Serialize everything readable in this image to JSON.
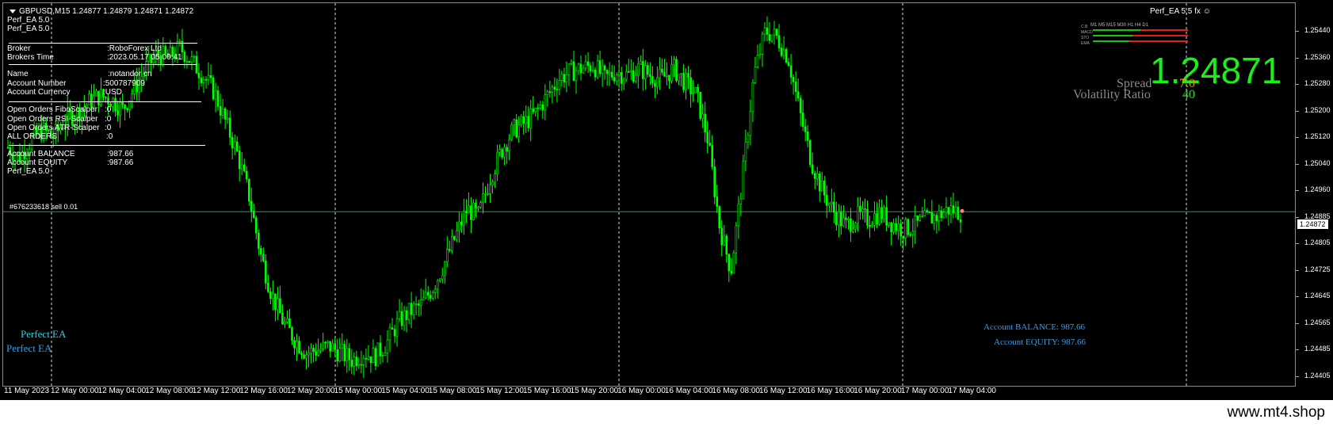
{
  "chart": {
    "symbol_line": "GBPUSD,M15  1.24877 1.24879 1.24871 1.24872",
    "ea_title_right": "Perf_EA 5.5",
    "ea_title_suffix": "fx",
    "ea_name_1": "Perf_EA 5.0",
    "ea_name_2": "Perf_EA 5.0",
    "current_price_tag": "1.24872",
    "order_line_label": "#676233618 sell 0.01"
  },
  "info_panel": {
    "broker_label": "Broker",
    "broker_value": ":RoboForex Ltd",
    "brokers_time_label": "Brokers Time",
    "brokers_time_value": ":2023.05.17 05:00:41",
    "name_label": "Name",
    "name_value": ":notandor cn",
    "account_number_label": "Account Number",
    "account_number_value": ":500787909",
    "account_currency_label": "Account Currency",
    "account_currency_value": ":USD",
    "oo_fibo_label": "Open Orders FiboScalper",
    "oo_fibo_value": ":0",
    "oo_rsi_label": "Open Orders RSI-Scalper",
    "oo_rsi_value": ":0",
    "oo_atr_label": "Open Orders ATR-Scalper",
    "oo_atr_value": ":0",
    "all_orders_label": "ALL ORDERS",
    "all_orders_value": ":0",
    "balance_label": "Account BALANCE",
    "balance_value": ":987.66",
    "equity_label": "Account EQUITY",
    "equity_value": ":987.66",
    "footer_name": "Perf_EA 5.0"
  },
  "quote_panel": {
    "big_price": "1.24871",
    "spread_label": "Spread",
    "spread_value": "7.0",
    "volatility_label": "Volatility Ratio",
    "volatility_value": "40",
    "timeframes": [
      "M1",
      "M5",
      "M15",
      "M30",
      "H1",
      "H4",
      "D1"
    ],
    "indicator_rows": [
      "C.B",
      "MACD",
      "STO",
      "EMA"
    ]
  },
  "bottom_left": {
    "label_1": "Perfect EA",
    "label_2": "Perfect EA"
  },
  "bottom_right": {
    "balance_text": "Account BALANCE:  987.66",
    "equity_text": "Account EQUITY:  987.66"
  },
  "price_axis": [
    "1.25440",
    "1.25360",
    "1.25280",
    "1.25200",
    "1.25120",
    "1.25040",
    "1.24960",
    "1.24885",
    "1.24805",
    "1.24725",
    "1.24645",
    "1.24565",
    "1.24485",
    "1.24405"
  ],
  "time_axis": [
    "11 May 2023",
    "12 May 00:00",
    "12 May 04:00",
    "12 May 08:00",
    "12 May 12:00",
    "12 May 16:00",
    "12 May 20:00",
    "15 May 00:00",
    "15 May 04:00",
    "15 May 08:00",
    "15 May 12:00",
    "15 May 16:00",
    "15 May 20:00",
    "16 May 00:00",
    "16 May 04:00",
    "16 May 08:00",
    "16 May 12:00",
    "16 May 16:00",
    "16 May 20:00",
    "17 May 00:00",
    "17 May 04:00"
  ],
  "footer": {
    "brand": "www.mt4.shop"
  },
  "colors": {
    "candle": "#00ff00",
    "price_big": "#19f019",
    "spread_value": "#ff8c00",
    "volatility_value": "#19f019",
    "order_line": "#1f9f6a",
    "bottom_left_label_1": "#2fd0e0",
    "bottom_left_label_2": "#2fa0e0",
    "bottom_right_text": "#3a9ae8"
  },
  "chart_data": {
    "type": "candlestick",
    "symbol": "GBPUSD",
    "timeframe": "M15",
    "ohlc_last": {
      "open": 1.24877,
      "high": 1.24879,
      "low": 1.24871,
      "close": 1.24872
    },
    "price_path": [
      1.2506,
      1.2503,
      1.2508,
      1.2511,
      1.2509,
      1.2514,
      1.2516,
      1.2519,
      1.2521,
      1.252,
      1.2517,
      1.2523,
      1.2529,
      1.2533,
      1.2532,
      1.2535,
      1.2531,
      1.2527,
      1.2522,
      1.2513,
      1.2504,
      1.2492,
      1.2475,
      1.2463,
      1.2455,
      1.245,
      1.2446,
      1.2447,
      1.2448,
      1.2446,
      1.2444,
      1.2446,
      1.2445,
      1.2449,
      1.2455,
      1.2458,
      1.246,
      1.2465,
      1.2472,
      1.248,
      1.2488,
      1.2486,
      1.2497,
      1.2505,
      1.2511,
      1.2513,
      1.2516,
      1.2521,
      1.2526,
      1.2528,
      1.2529,
      1.253,
      1.2526,
      1.2528,
      1.2527,
      1.2529,
      1.2527,
      1.2526,
      1.2529,
      1.2525,
      1.2521,
      1.2508,
      1.2483,
      1.247,
      1.2497,
      1.2527,
      1.254,
      1.2538,
      1.2532,
      1.2516,
      1.2502,
      1.2493,
      1.2487,
      1.2483,
      1.2486,
      1.2485,
      1.2487,
      1.2484,
      1.2482,
      1.2483,
      1.2485,
      1.2486,
      1.2488,
      1.2487
    ]
  }
}
